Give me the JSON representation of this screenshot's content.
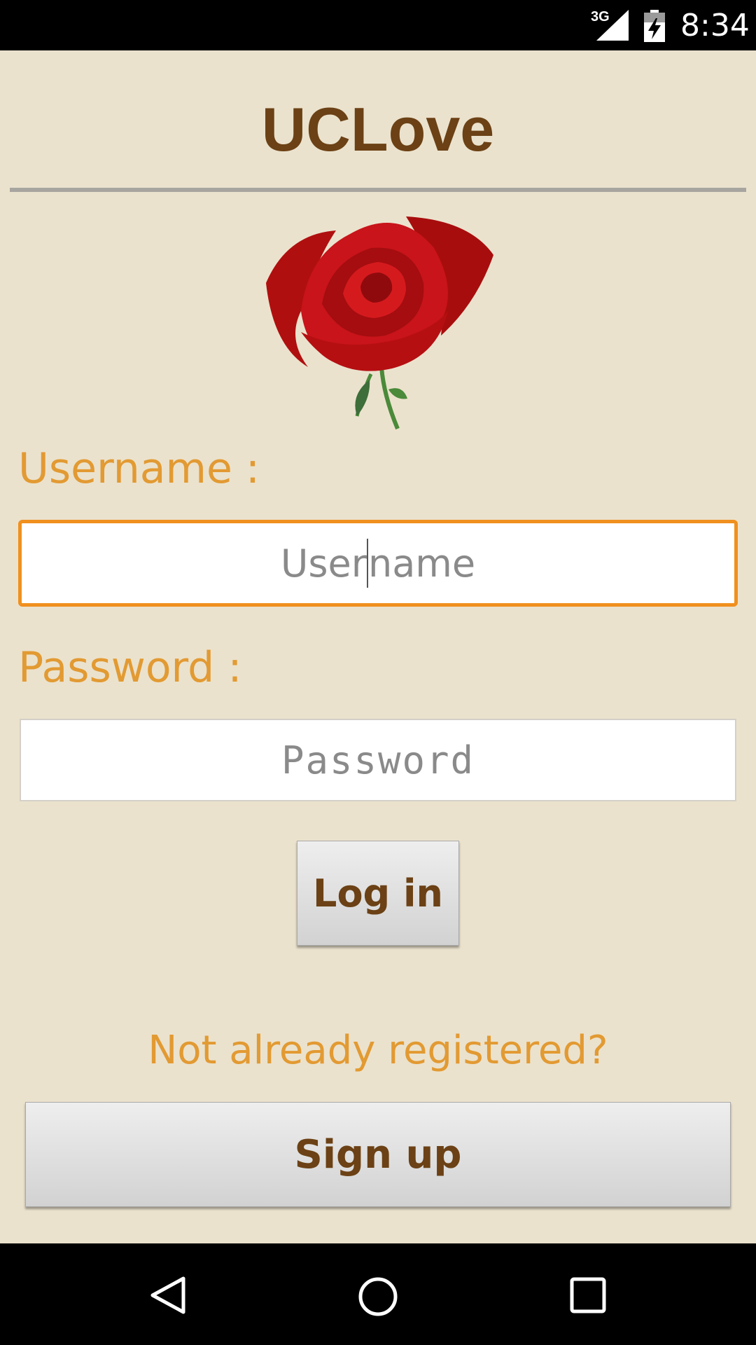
{
  "status_bar": {
    "network": "3G",
    "time": "8:34",
    "icons": [
      "signal-icon",
      "battery-charging-icon"
    ]
  },
  "app": {
    "title": "UCLove",
    "logo_icon": "rose-icon"
  },
  "login_form": {
    "username_label": "Username :",
    "username_placeholder_before": "User",
    "username_placeholder_after": "name",
    "password_label": "Password :",
    "password_placeholder": "Password",
    "login_button": "Log in",
    "register_prompt": "Not already registered?",
    "signup_button": "Sign up"
  },
  "colors": {
    "background": "#ebe2cd",
    "title": "#6b4115",
    "accent": "#e29a32",
    "focus_border": "#f0901e"
  },
  "nav_bar": {
    "icons": [
      "back-icon",
      "home-icon",
      "recents-icon"
    ]
  }
}
